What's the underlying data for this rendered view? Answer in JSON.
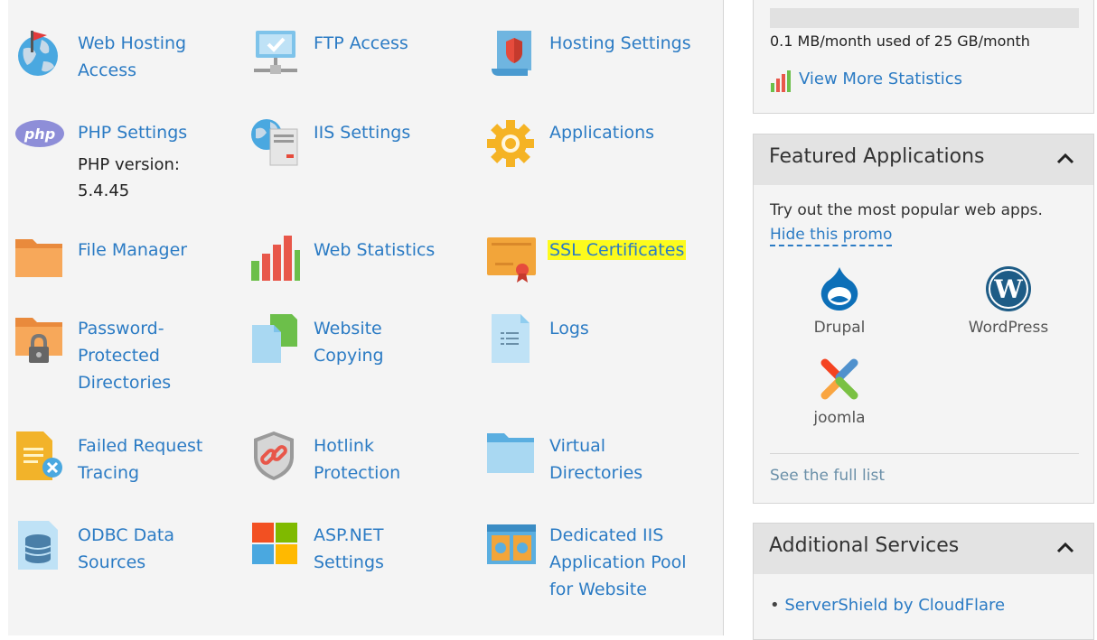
{
  "tools": [
    {
      "id": "web-hosting-access",
      "label": "Web Hosting Access",
      "icon": "globe-flag-icon"
    },
    {
      "id": "ftp-access",
      "label": "FTP Access",
      "icon": "ftp-monitor-icon"
    },
    {
      "id": "hosting-settings",
      "label": "Hosting Settings",
      "icon": "hosting-settings-shield-icon"
    },
    {
      "id": "php-settings",
      "label": "PHP Settings",
      "icon": "php-icon",
      "sub": "PHP version:\n5.4.45"
    },
    {
      "id": "iis-settings",
      "label": "IIS Settings",
      "icon": "iis-server-icon"
    },
    {
      "id": "applications",
      "label": "Applications",
      "icon": "gear-icon"
    },
    {
      "id": "file-manager",
      "label": "File Manager",
      "icon": "folder-icon"
    },
    {
      "id": "web-statistics",
      "label": "Web Statistics",
      "icon": "bar-chart-icon"
    },
    {
      "id": "ssl-certificates",
      "label": "SSL Certificates",
      "icon": "certificate-icon",
      "highlight": "#fdfb1d"
    },
    {
      "id": "password-protected-directories",
      "label": "Password-Protected Directories",
      "icon": "locked-folder-icon"
    },
    {
      "id": "website-copying",
      "label": "Website Copying",
      "icon": "copy-pages-icon"
    },
    {
      "id": "logs",
      "label": "Logs",
      "icon": "log-file-icon"
    },
    {
      "id": "failed-request-tracing",
      "label": "Failed Request Tracing",
      "icon": "failed-request-icon"
    },
    {
      "id": "hotlink-protection",
      "label": "Hotlink Protection",
      "icon": "hotlink-shield-icon"
    },
    {
      "id": "virtual-directories",
      "label": "Virtual Directories",
      "icon": "virtual-folder-icon"
    },
    {
      "id": "odbc-data-sources",
      "label": "ODBC Data Sources",
      "icon": "database-icon"
    },
    {
      "id": "asp-net-settings",
      "label": "ASP.NET Settings",
      "icon": "windows-logo-icon"
    },
    {
      "id": "dedicated-iis-pool",
      "label": "Dedicated IIS Application Pool for Website",
      "icon": "app-pool-icon"
    }
  ],
  "stats": {
    "usage_text": "0.1 MB/month used of 25 GB/month",
    "usage_fraction": 4e-06,
    "more_link": "View More Statistics"
  },
  "featured": {
    "title": "Featured Applications",
    "intro": "Try out the most popular web apps.",
    "hide_link": "Hide this promo",
    "apps": [
      {
        "name": "Drupal",
        "icon": "drupal-icon"
      },
      {
        "name": "WordPress",
        "icon": "wordpress-icon"
      },
      {
        "name": "joomla",
        "icon": "joomla-icon"
      }
    ],
    "full_list": "See the full list"
  },
  "additional": {
    "title": "Additional Services",
    "items": [
      "ServerShield by CloudFlare"
    ]
  },
  "colors": {
    "link": "#2b7bc4",
    "highlight": "#fdfb1d",
    "panel_head": "#e3e3e3",
    "panel_bg": "#f4f4f4"
  }
}
